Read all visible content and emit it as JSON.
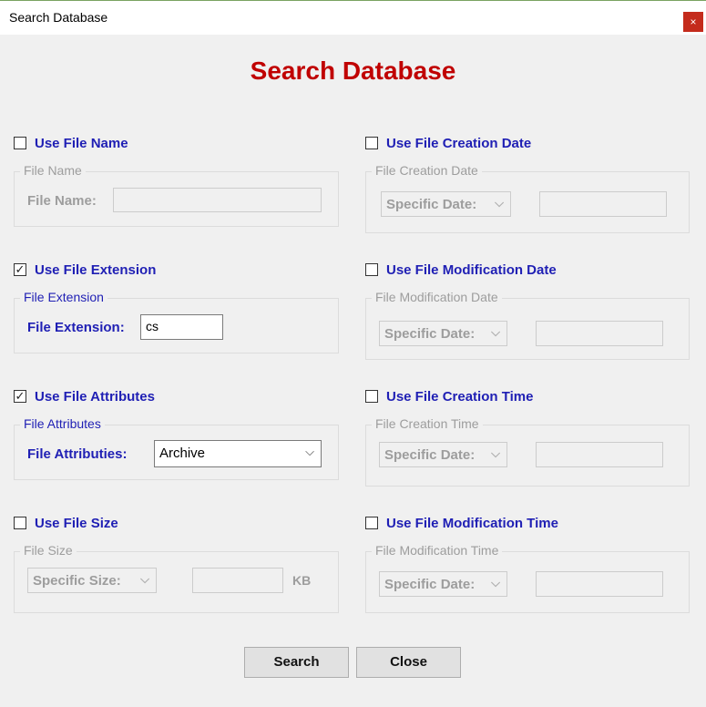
{
  "window": {
    "title": "Search Database",
    "close_glyph": "×"
  },
  "heading": "Search Database",
  "left": {
    "file_name": {
      "checkbox_label": "Use File Name",
      "checked": false,
      "group_title": "File Name",
      "field_label": "File Name:",
      "value": ""
    },
    "file_extension": {
      "checkbox_label": "Use File Extension",
      "checked": true,
      "group_title": "File Extension",
      "field_label": "File Extension:",
      "value": "cs"
    },
    "file_attributes": {
      "checkbox_label": "Use File Attributes",
      "checked": true,
      "group_title": "File Attributes",
      "field_label": "File Attributies:",
      "selected": "Archive"
    },
    "file_size": {
      "checkbox_label": "Use File Size",
      "checked": false,
      "group_title": "File Size",
      "mode": "Specific Size:",
      "value": "",
      "unit": "KB"
    }
  },
  "right": {
    "creation_date": {
      "checkbox_label": "Use File Creation Date",
      "checked": false,
      "group_title": "File Creation Date",
      "mode": "Specific Date:",
      "value": ""
    },
    "modification_date": {
      "checkbox_label": "Use File Modification Date",
      "checked": false,
      "group_title": "File Modification Date",
      "mode": "Specific Date:",
      "value": ""
    },
    "creation_time": {
      "checkbox_label": "Use File Creation Time",
      "checked": false,
      "group_title": "File Creation Time",
      "mode": "Specific Date:",
      "value": ""
    },
    "modification_time": {
      "checkbox_label": "Use File Modification Time",
      "checked": false,
      "group_title": "File Modification Time",
      "mode": "Specific Date:",
      "value": ""
    }
  },
  "buttons": {
    "search": "Search",
    "close": "Close"
  },
  "glyphs": {
    "check": "✓",
    "chevron": "⌵"
  },
  "icons": {
    "chevron_down": "chevron-down-icon",
    "checkmark": "checkmark-icon",
    "close": "close-icon"
  },
  "colors": {
    "heading": "#c00000",
    "label": "#1f1fb4",
    "disabled": "#9d9d9d",
    "close_button": "#c42b1c"
  }
}
